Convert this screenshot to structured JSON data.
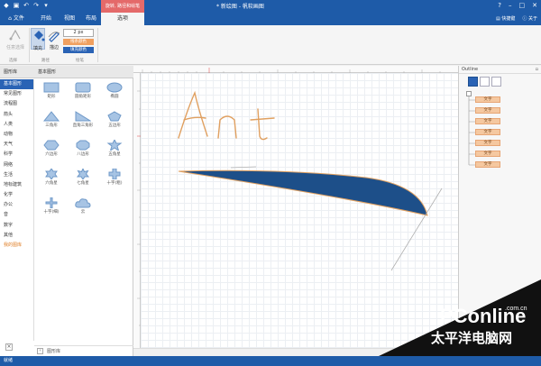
{
  "window": {
    "doc_title": "* 新绘图 - 帆软画图",
    "context_tab_title": "旋转, 路径和绘笔"
  },
  "tabs": {
    "file": "文件",
    "start": "开始",
    "view": "视图",
    "layout": "布局",
    "options": "选项"
  },
  "account": {
    "share": "快捷键",
    "about": "关于"
  },
  "ribbon": {
    "select_path": "任意选择",
    "fill": "填充",
    "stroke": "描边",
    "size_value": "2 px",
    "line_color": "线条颜色",
    "fill_color": "填充颜色",
    "group_select": "选择",
    "group_path": "路径",
    "group_brush": "绘笔"
  },
  "left_panel": {
    "head_categories": "图形库",
    "head_shapes": "基本图形",
    "categories": [
      "基本图形",
      "常见图形",
      "流程图",
      "箭头",
      "人类",
      "动物",
      "天气",
      "科学",
      "网络",
      "生活",
      "地标建筑",
      "化学",
      "办公",
      "音",
      "数字",
      "其他",
      "我的图库"
    ],
    "shapes": [
      {
        "label": "矩形"
      },
      {
        "label": "圆角矩形"
      },
      {
        "label": "椭圆"
      },
      {
        "label": "三角形"
      },
      {
        "label": "直角三角形"
      },
      {
        "label": "五边形"
      },
      {
        "label": "六边形"
      },
      {
        "label": "八边形"
      },
      {
        "label": "五角星"
      },
      {
        "label": "六角星"
      },
      {
        "label": "七角星"
      },
      {
        "label": "十字(粗)"
      },
      {
        "label": "十字(细)"
      },
      {
        "label": "云"
      }
    ],
    "footer": "图形库"
  },
  "canvas": {
    "handwriting": "Ant",
    "fill_color": "#1d4f89",
    "stroke_color": "#e0a060"
  },
  "outline": {
    "title": "Outline",
    "items": [
      "文字",
      "文字",
      "文字",
      "文字",
      "文字",
      "文字",
      "文字"
    ]
  },
  "status": {
    "text": "就绪"
  },
  "watermark": {
    "brand": "PConline",
    "domain": ".com.cn",
    "chinese": "太平洋电脑网"
  }
}
